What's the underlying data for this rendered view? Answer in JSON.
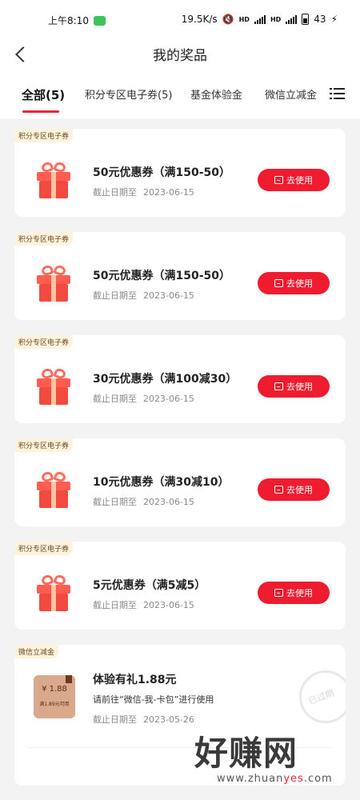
{
  "status_bar": {
    "time": "上午8:10",
    "net_speed": "19.5K/s",
    "hd": "HD",
    "battery": "43"
  },
  "header": {
    "title": "我的奖品"
  },
  "tabs": [
    {
      "label": "全部(5)",
      "active": true
    },
    {
      "label": "积分专区电子券(5)",
      "active": false
    },
    {
      "label": "基金体验金",
      "active": false
    },
    {
      "label": "微信立减金",
      "active": false
    }
  ],
  "accent_color": "#ef1c2f",
  "coupons": [
    {
      "tag": "积分专区电子券",
      "title": "50元优惠券（满150-50）",
      "date_label": "截止日期至",
      "date": "2023-06-15",
      "button": "去使用"
    },
    {
      "tag": "积分专区电子券",
      "title": "50元优惠券（满150-50）",
      "date_label": "截止日期至",
      "date": "2023-06-15",
      "button": "去使用"
    },
    {
      "tag": "积分专区电子券",
      "title": "30元优惠券（满100减30）",
      "date_label": "截止日期至",
      "date": "2023-06-15",
      "button": "去使用"
    },
    {
      "tag": "积分专区电子券",
      "title": "10元优惠券（满30减10）",
      "date_label": "截止日期至",
      "date": "2023-06-15",
      "button": "去使用"
    },
    {
      "tag": "积分专区电子券",
      "title": "5元优惠券（满5减5）",
      "date_label": "截止日期至",
      "date": "2023-06-15",
      "button": "去使用"
    }
  ],
  "wechat_card": {
    "tag": "微信立减金",
    "coupon_amount": "¥ 1.88",
    "coupon_condition": "满1.89元可用",
    "title": "体验有礼1.88元",
    "desc": "请前往“微信-我-卡包”进行使用",
    "date_label": "截止日期至",
    "date": "2023-05-26",
    "stamp": "已过期"
  },
  "watermark": {
    "main": "好赚网",
    "url_a": "www.zhuan",
    "url_b": "yes",
    "url_c": ".com"
  }
}
